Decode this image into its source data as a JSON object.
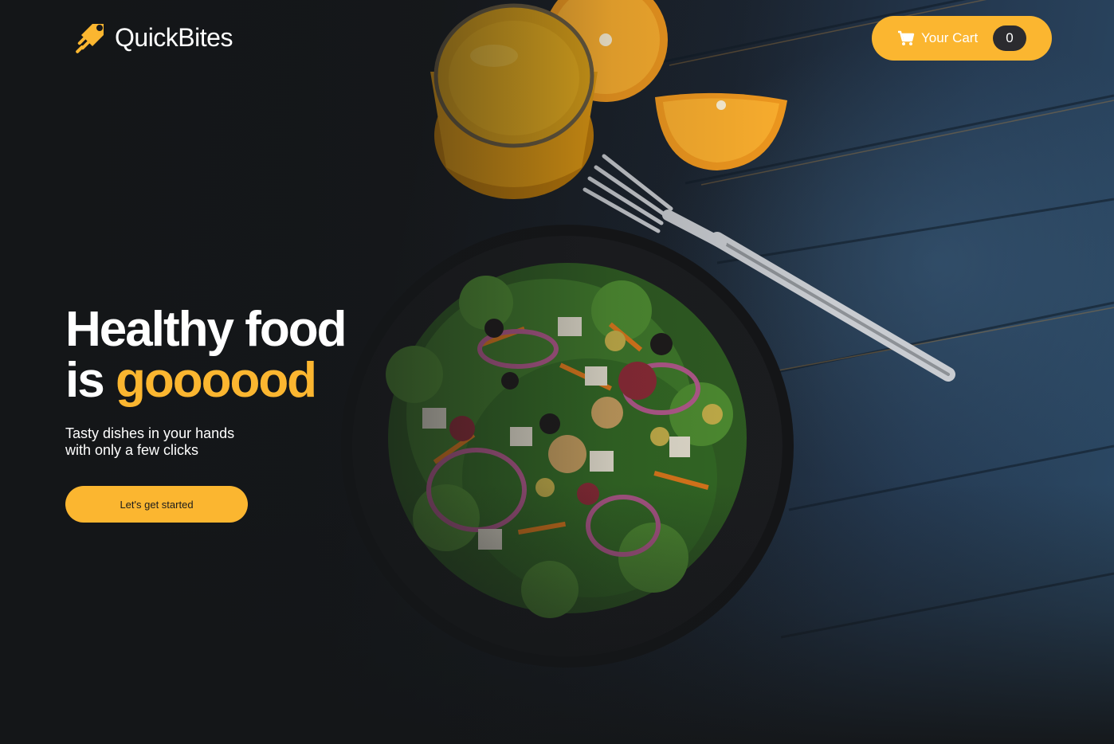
{
  "brand": {
    "name": "QuickBites",
    "icon": "rocket-icon"
  },
  "header": {
    "cart_label": "Your Cart",
    "cart_count": "0",
    "cart_icon": "shopping-cart-icon"
  },
  "hero": {
    "headline_line1": "Healthy food",
    "headline_is": "is",
    "headline_accent": "goooood",
    "subtitle_line1": "Tasty dishes in your hands",
    "subtitle_line2": "with only a few clicks",
    "cta_label": "Let's get started"
  },
  "colors": {
    "accent": "#fbb630",
    "background": "#16181b",
    "badge": "#2b2b2f"
  }
}
